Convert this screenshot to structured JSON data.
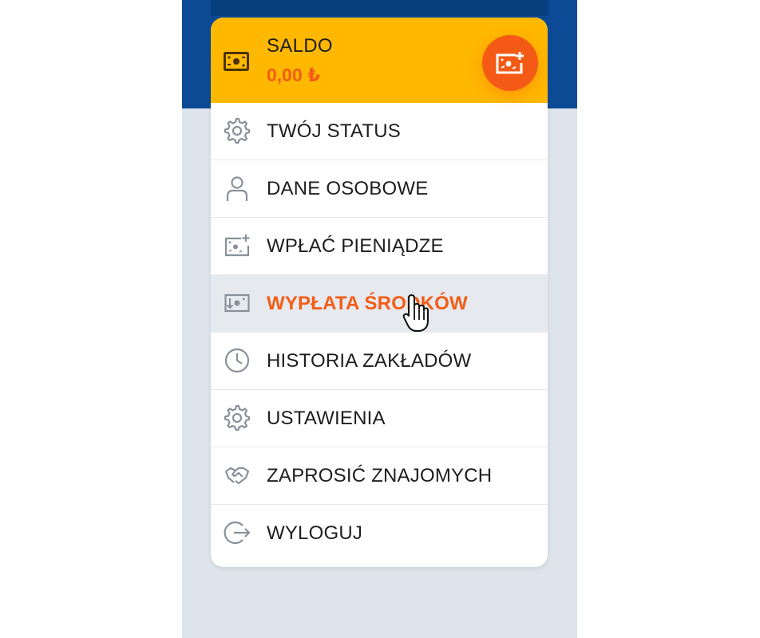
{
  "balance": {
    "label": "SALDO",
    "amount": "0,00 ₺",
    "icon": "banknote-icon",
    "deposit_button_icon": "banknote-plus-icon"
  },
  "menu": {
    "items": [
      {
        "label": "TWÓJ STATUS",
        "icon": "gear-icon"
      },
      {
        "label": "DANE OSOBOWE",
        "icon": "user-icon"
      },
      {
        "label": "WPŁAĆ PIENIĄDZE",
        "icon": "banknote-plus-icon"
      },
      {
        "label": "WYPŁATA ŚRODKÓW",
        "icon": "banknote-withdraw-icon",
        "active": true
      },
      {
        "label": "HISTORIA ZAKŁADÓW",
        "icon": "clock-icon"
      },
      {
        "label": "USTAWIENIA",
        "icon": "gear-icon"
      },
      {
        "label": "ZAPROSIĆ ZNAJOMYCH",
        "icon": "handshake-icon"
      },
      {
        "label": "WYLOGUJ",
        "icon": "logout-icon"
      }
    ]
  },
  "colors": {
    "header_yellow": "#ffb800",
    "accent_orange": "#f25d16",
    "nav_blue": "#0d4a96",
    "backdrop_gray": "#dde4eb",
    "active_row": "#e6e9ee",
    "icon_gray": "#8a9099"
  }
}
